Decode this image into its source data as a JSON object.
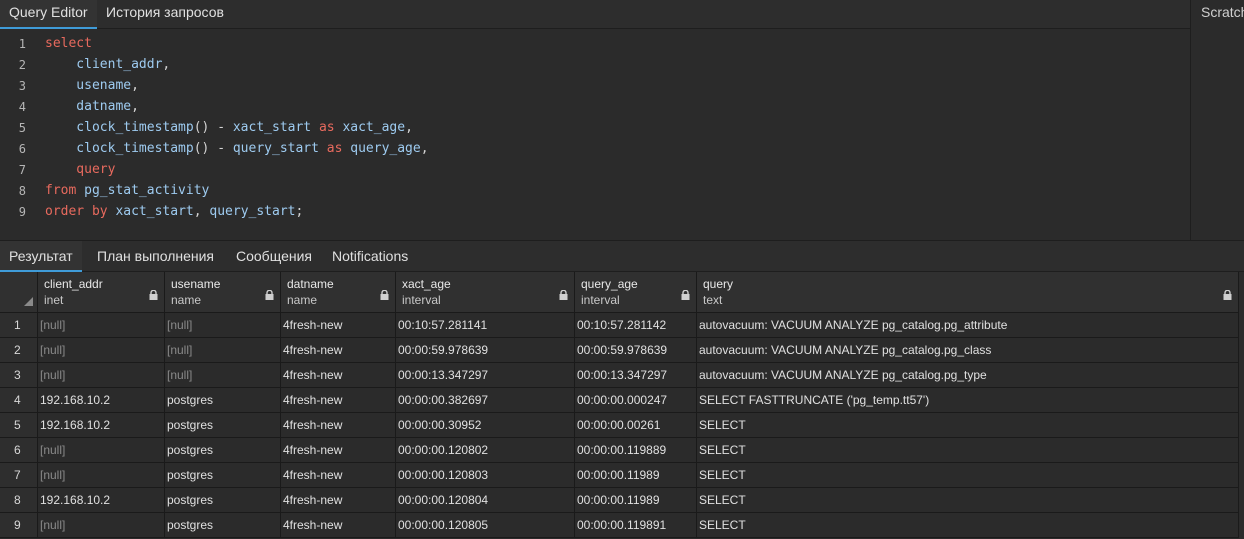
{
  "top_tabs": [
    "Query Editor",
    "История запросов"
  ],
  "scratch_label": "Scratch",
  "editor": {
    "line_numbers": [
      "1",
      "2",
      "3",
      "4",
      "5",
      "6",
      "7",
      "8",
      "9"
    ],
    "lines": [
      [
        {
          "t": "select",
          "c": "kw"
        }
      ],
      [
        {
          "t": "    client_addr",
          "c": "id"
        },
        {
          "t": ",",
          "c": "op"
        }
      ],
      [
        {
          "t": "    usename",
          "c": "id"
        },
        {
          "t": ",",
          "c": "op"
        }
      ],
      [
        {
          "t": "    datname",
          "c": "id"
        },
        {
          "t": ",",
          "c": "op"
        }
      ],
      [
        {
          "t": "    clock_timestamp",
          "c": "id"
        },
        {
          "t": "() - ",
          "c": "op"
        },
        {
          "t": "xact_start",
          "c": "id"
        },
        {
          "t": " as ",
          "c": "kw"
        },
        {
          "t": "xact_age",
          "c": "id"
        },
        {
          "t": ",",
          "c": "op"
        }
      ],
      [
        {
          "t": "    clock_timestamp",
          "c": "id"
        },
        {
          "t": "() - ",
          "c": "op"
        },
        {
          "t": "query_start",
          "c": "id"
        },
        {
          "t": " as ",
          "c": "kw"
        },
        {
          "t": "query_age",
          "c": "id"
        },
        {
          "t": ",",
          "c": "op"
        }
      ],
      [
        {
          "t": "    query",
          "c": "kw"
        }
      ],
      [
        {
          "t": "from ",
          "c": "kw"
        },
        {
          "t": "pg_stat_activity",
          "c": "id"
        }
      ],
      [
        {
          "t": "order by ",
          "c": "kw"
        },
        {
          "t": "xact_start",
          "c": "id"
        },
        {
          "t": ", ",
          "c": "op"
        },
        {
          "t": "query_start",
          "c": "id"
        },
        {
          "t": ";",
          "c": "op"
        }
      ]
    ]
  },
  "result_tabs": [
    "Результат",
    "План выполнения",
    "Сообщения",
    "Notifications"
  ],
  "grid": {
    "columns": [
      {
        "name": "client_addr",
        "type": "inet"
      },
      {
        "name": "usename",
        "type": "name"
      },
      {
        "name": "datname",
        "type": "name"
      },
      {
        "name": "xact_age",
        "type": "interval"
      },
      {
        "name": "query_age",
        "type": "interval"
      },
      {
        "name": "query",
        "type": "text"
      }
    ],
    "rows": [
      [
        "1",
        "[null]",
        "[null]",
        "4fresh-new",
        "00:10:57.281141",
        "00:10:57.281142",
        "autovacuum: VACUUM ANALYZE pg_catalog.pg_attribute"
      ],
      [
        "2",
        "[null]",
        "[null]",
        "4fresh-new",
        "00:00:59.978639",
        "00:00:59.978639",
        "autovacuum: VACUUM ANALYZE pg_catalog.pg_class"
      ],
      [
        "3",
        "[null]",
        "[null]",
        "4fresh-new",
        "00:00:13.347297",
        "00:00:13.347297",
        "autovacuum: VACUUM ANALYZE pg_catalog.pg_type"
      ],
      [
        "4",
        "192.168.10.2",
        "postgres",
        "4fresh-new",
        "00:00:00.382697",
        "00:00:00.000247",
        "SELECT FASTTRUNCATE ('pg_temp.tt57')"
      ],
      [
        "5",
        "192.168.10.2",
        "postgres",
        "4fresh-new",
        "00:00:00.30952",
        "00:00:00.00261",
        "SELECT"
      ],
      [
        "6",
        "[null]",
        "postgres",
        "4fresh-new",
        "00:00:00.120802",
        "00:00:00.119889",
        "SELECT"
      ],
      [
        "7",
        "[null]",
        "postgres",
        "4fresh-new",
        "00:00:00.120803",
        "00:00:00.11989",
        "SELECT"
      ],
      [
        "8",
        "192.168.10.2",
        "postgres",
        "4fresh-new",
        "00:00:00.120804",
        "00:00:00.11989",
        "SELECT"
      ],
      [
        "9",
        "[null]",
        "postgres",
        "4fresh-new",
        "00:00:00.120805",
        "00:00:00.119891",
        "SELECT"
      ]
    ]
  },
  "icons": {
    "lock": "lock-icon",
    "corner": "sort-corner-icon"
  },
  "colors": {
    "accent": "#3f9bd8",
    "keyword": "#e86a5e",
    "identifier": "#9ecbf0",
    "null_text": "#8a8a8a"
  }
}
